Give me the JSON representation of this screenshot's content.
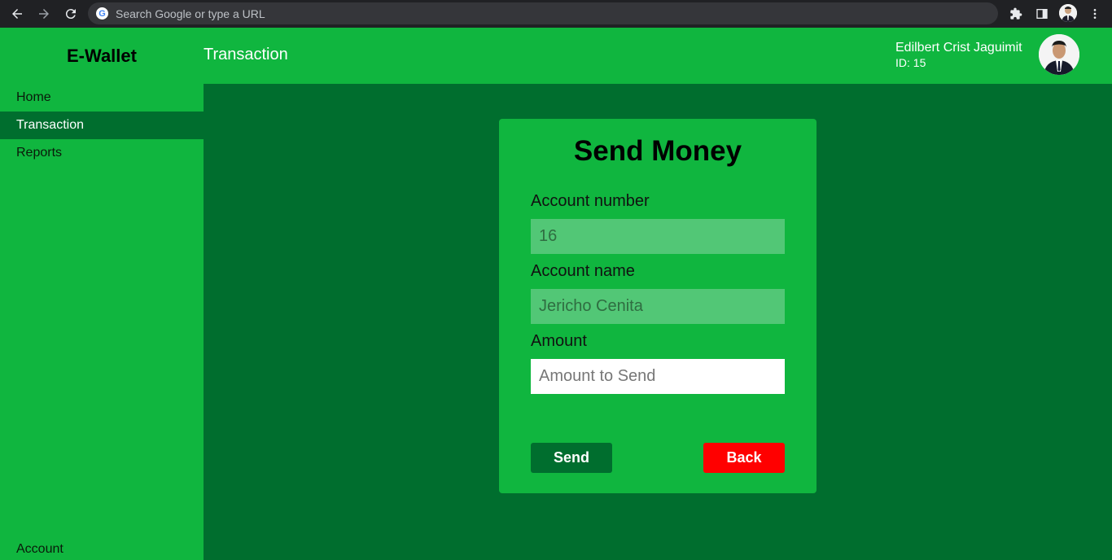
{
  "browser": {
    "omnibox_placeholder": "Search Google or type a URL",
    "icons": [
      "back-icon",
      "forward-icon",
      "reload-icon",
      "google-icon",
      "extensions-icon",
      "side-panel-icon",
      "profile-icon",
      "more-icon"
    ]
  },
  "sidebar": {
    "brand": "E-Wallet",
    "items": [
      {
        "label": "Home",
        "active": false
      },
      {
        "label": "Transaction",
        "active": true
      },
      {
        "label": "Reports",
        "active": false
      }
    ],
    "account_label": "Account"
  },
  "header": {
    "title": "Transaction",
    "user_name": "Edilbert Crist Jaguimit",
    "user_id": "ID: 15"
  },
  "form": {
    "title": "Send Money",
    "account_number_label": "Account number",
    "account_number_value": "16",
    "account_name_label": "Account name",
    "account_name_value": "Jericho Cenita",
    "amount_label": "Amount",
    "amount_placeholder": "Amount to Send",
    "amount_value": "",
    "send_label": "Send",
    "back_label": "Back"
  },
  "colors": {
    "primary_green": "#10b63f",
    "dark_green": "#006e2e",
    "back_red": "#ff0000"
  }
}
